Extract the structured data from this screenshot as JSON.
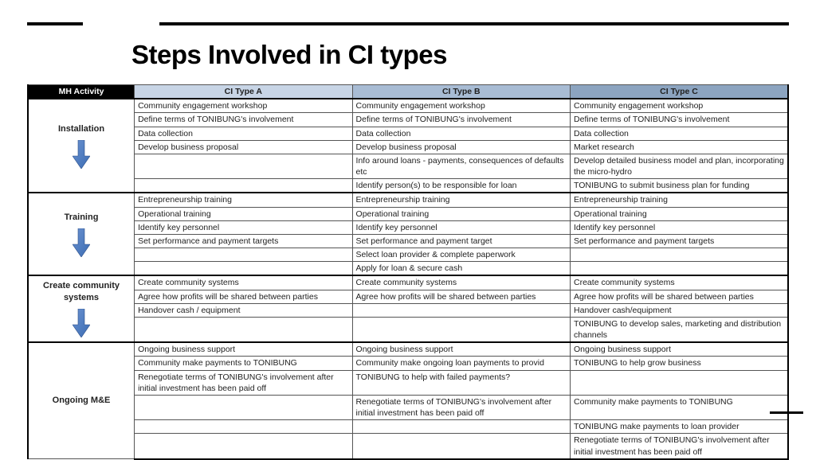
{
  "title": "Steps Involved in CI types",
  "headers": {
    "mh": "MH Activity",
    "a": "CI Type A",
    "b": "CI Type B",
    "c": "CI Type C"
  },
  "phases": [
    {
      "label": "Installation",
      "rows": [
        {
          "a": "Community engagement workshop",
          "b": "Community engagement workshop",
          "c": "Community engagement workshop"
        },
        {
          "a": "Define terms of TONIBUNG's involvement",
          "b": "Define terms of TONIBUNG's involvement",
          "c": "Define terms of TONIBUNG's involvement"
        },
        {
          "a": "Data collection",
          "b": "Data collection",
          "c": "Data collection"
        },
        {
          "a": "Develop business proposal",
          "b": "Develop business proposal",
          "c": "Market research"
        },
        {
          "a": "",
          "b": "Info around loans - payments, consequences of defaults etc",
          "c": "Develop detailed business model and plan, incorporating the micro-hydro"
        },
        {
          "a": "",
          "b": "Identify person(s) to be responsible for loan",
          "c": "TONIBUNG to submit business plan for funding"
        }
      ]
    },
    {
      "label": "Training",
      "rows": [
        {
          "a": "Entrepreneurship training",
          "b": "Entrepreneurship training",
          "c": "Entrepreneurship training"
        },
        {
          "a": "Operational training",
          "b": "Operational training",
          "c": "Operational training"
        },
        {
          "a": "Identify key personnel",
          "b": "Identify key personnel",
          "c": "Identify key personnel"
        },
        {
          "a": "Set performance and payment targets",
          "b": "Set performance and payment target",
          "c": "Set performance and payment targets"
        },
        {
          "a": "",
          "b": "Select loan provider & complete paperwork",
          "c": ""
        },
        {
          "a": "",
          "b": "Apply for loan & secure cash",
          "c": ""
        }
      ]
    },
    {
      "label": "Create community systems",
      "rows": [
        {
          "a": "Create community systems",
          "b": "Create community systems",
          "c": "Create community systems"
        },
        {
          "a": "Agree how profits will be shared between parties",
          "b": "Agree how profits will be shared between parties",
          "c": "Agree how profits will be shared between parties"
        },
        {
          "a": "Handover cash / equipment",
          "b": "",
          "c": "Handover cash/equipment"
        },
        {
          "a": "",
          "b": "",
          "c": "TONIBUNG to develop sales, marketing and distribution channels"
        }
      ]
    },
    {
      "label": "Ongoing M&E",
      "rows": [
        {
          "a": "Ongoing business support",
          "b": "Ongoing business support",
          "c": "Ongoing business support"
        },
        {
          "a": "Community make payments to TONIBUNG",
          "b": "Community make ongoing loan payments to provid",
          "c": "TONIBUNG to help grow business"
        },
        {
          "a": "Renegotiate terms of TONIBUNG's involvement after initial investment has been paid off",
          "b": "TONIBUNG to help with failed payments?",
          "c": ""
        },
        {
          "a": "",
          "b": "Renegotiate terms of TONIBUNG's involvement after initial investment has been paid off",
          "c": "Community make payments to TONIBUNG"
        },
        {
          "a": "",
          "b": "",
          "c": "TONIBUNG make payments to loan provider"
        },
        {
          "a": "",
          "b": "",
          "c": "Renegotiate terms of TONIBUNG's involvement after initial investment has been paid off"
        }
      ]
    }
  ]
}
